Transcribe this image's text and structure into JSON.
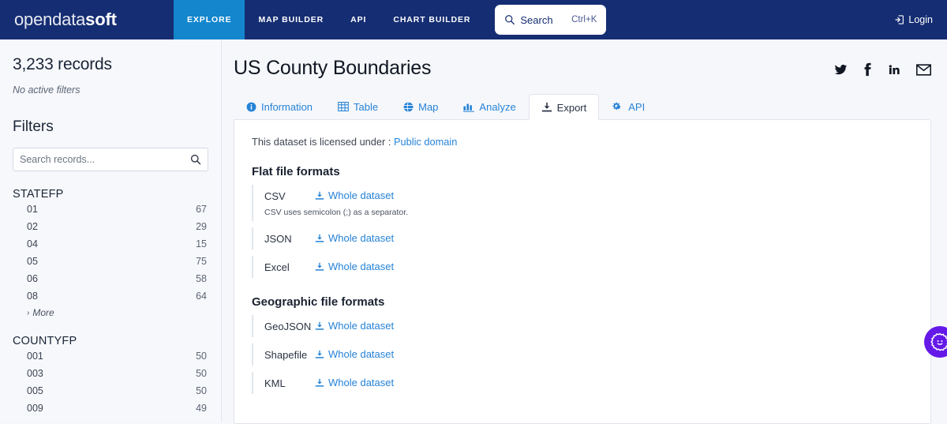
{
  "topnav": {
    "logo_light": "opendata",
    "logo_bold": "soft",
    "items": [
      {
        "label": "EXPLORE",
        "active": true
      },
      {
        "label": "MAP BUILDER",
        "active": false
      },
      {
        "label": "API",
        "active": false
      },
      {
        "label": "CHART BUILDER",
        "active": false
      }
    ],
    "search": {
      "label": "Search",
      "shortcut": "Ctrl+K",
      "icon": "search-icon"
    },
    "login": {
      "label": "Login",
      "icon": "login-icon"
    }
  },
  "sidebar": {
    "record_count": "3,233 records",
    "active_filters": "No active filters",
    "filters_heading": "Filters",
    "search_placeholder": "Search records...",
    "search_value": "",
    "facets": [
      {
        "name": "STATEFP",
        "values": [
          {
            "label": "01",
            "count": "67"
          },
          {
            "label": "02",
            "count": "29"
          },
          {
            "label": "04",
            "count": "15"
          },
          {
            "label": "05",
            "count": "75"
          },
          {
            "label": "06",
            "count": "58"
          },
          {
            "label": "08",
            "count": "64"
          }
        ],
        "more_label": "More"
      },
      {
        "name": "COUNTYFP",
        "values": [
          {
            "label": "001",
            "count": "50"
          },
          {
            "label": "003",
            "count": "50"
          },
          {
            "label": "005",
            "count": "50"
          },
          {
            "label": "009",
            "count": "49"
          }
        ],
        "more_label": ""
      }
    ]
  },
  "main": {
    "title": "US County Boundaries",
    "socials": [
      "twitter-icon",
      "facebook-icon",
      "linkedin-icon",
      "email-icon"
    ],
    "tabs": [
      {
        "label": "Information",
        "icon": "info-icon",
        "active": false
      },
      {
        "label": "Table",
        "icon": "table-icon",
        "active": false
      },
      {
        "label": "Map",
        "icon": "globe-icon",
        "active": false
      },
      {
        "label": "Analyze",
        "icon": "bar-chart-icon",
        "active": false
      },
      {
        "label": "Export",
        "icon": "download-icon",
        "active": true
      },
      {
        "label": "API",
        "icon": "gears-icon",
        "active": false
      }
    ],
    "license_prefix": "This dataset is licensed under : ",
    "license_link": "Public domain",
    "sections": [
      {
        "title": "Flat file formats",
        "formats": [
          {
            "name": "CSV",
            "link": "Whole dataset",
            "note": "CSV uses semicolon (;) as a separator."
          },
          {
            "name": "JSON",
            "link": "Whole dataset",
            "note": ""
          },
          {
            "name": "Excel",
            "link": "Whole dataset",
            "note": ""
          }
        ]
      },
      {
        "title": "Geographic file formats",
        "formats": [
          {
            "name": "GeoJSON",
            "link": "Whole dataset",
            "note": ""
          },
          {
            "name": "Shapefile",
            "link": "Whole dataset",
            "note": ""
          },
          {
            "name": "KML",
            "link": "Whole dataset",
            "note": ""
          }
        ]
      }
    ]
  },
  "fab": {
    "icon": "gear-badge-icon"
  },
  "colors": {
    "header_navy": "#152d72",
    "explore_blue": "#1386cd",
    "link_blue": "#2683d6",
    "fab_purple": "#6419e8",
    "page_bg": "#f6f7fb"
  }
}
